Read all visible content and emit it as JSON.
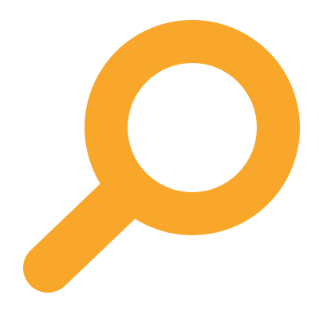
{
  "icon": {
    "name": "search-icon",
    "color": "#F9A72B",
    "background": "#FFFFFF"
  }
}
